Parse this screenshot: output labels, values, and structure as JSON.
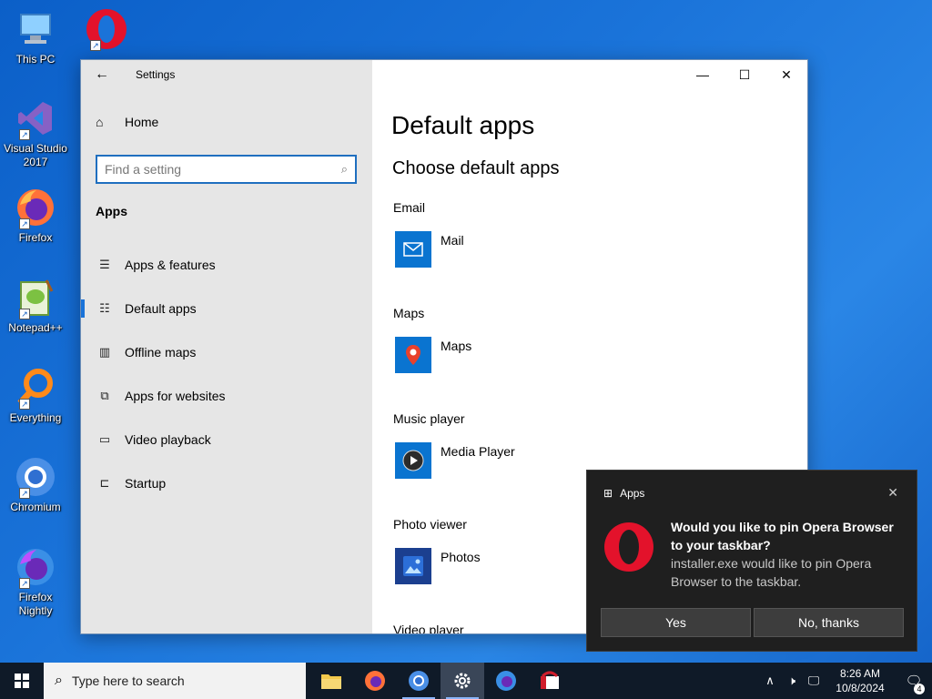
{
  "desktop": {
    "icons": [
      {
        "label": "This PC"
      },
      {
        "label": "Opera"
      },
      {
        "label": "Visual Studio 2017"
      },
      {
        "label": "Firefox"
      },
      {
        "label": "Notepad++"
      },
      {
        "label": "Everything"
      },
      {
        "label": "Chromium"
      },
      {
        "label": "Firefox Nightly"
      }
    ]
  },
  "settings": {
    "title": "Settings",
    "home_label": "Home",
    "search_placeholder": "Find a setting",
    "section": "Apps",
    "nav": [
      {
        "label": "Apps & features",
        "icon": "list-icon"
      },
      {
        "label": "Default apps",
        "icon": "default-apps-icon"
      },
      {
        "label": "Offline maps",
        "icon": "map-icon"
      },
      {
        "label": "Apps for websites",
        "icon": "open-in-new-icon"
      },
      {
        "label": "Video playback",
        "icon": "video-icon"
      },
      {
        "label": "Startup",
        "icon": "startup-icon"
      }
    ],
    "page_title": "Default apps",
    "sub_title": "Choose default apps",
    "categories": [
      {
        "label": "Email",
        "app": "Mail"
      },
      {
        "label": "Maps",
        "app": "Maps"
      },
      {
        "label": "Music player",
        "app": "Media Player"
      },
      {
        "label": "Photo viewer",
        "app": "Photos"
      },
      {
        "label": "Video player"
      }
    ]
  },
  "toast": {
    "source": "Apps",
    "title": "Would you like to pin Opera Browser to your taskbar?",
    "body": "installer.exe would like to pin Opera Browser to the taskbar.",
    "yes_label": "Yes",
    "no_label": "No, thanks"
  },
  "taskbar": {
    "search_placeholder": "Type here to search",
    "time": "8:26 AM",
    "date": "10/8/2024",
    "notification_count": "4"
  },
  "colors": {
    "accent": "#1a73d9",
    "tile_blue": "#0a74d0",
    "opera_red": "#e3122b",
    "toast_bg": "#1f1f1f"
  }
}
